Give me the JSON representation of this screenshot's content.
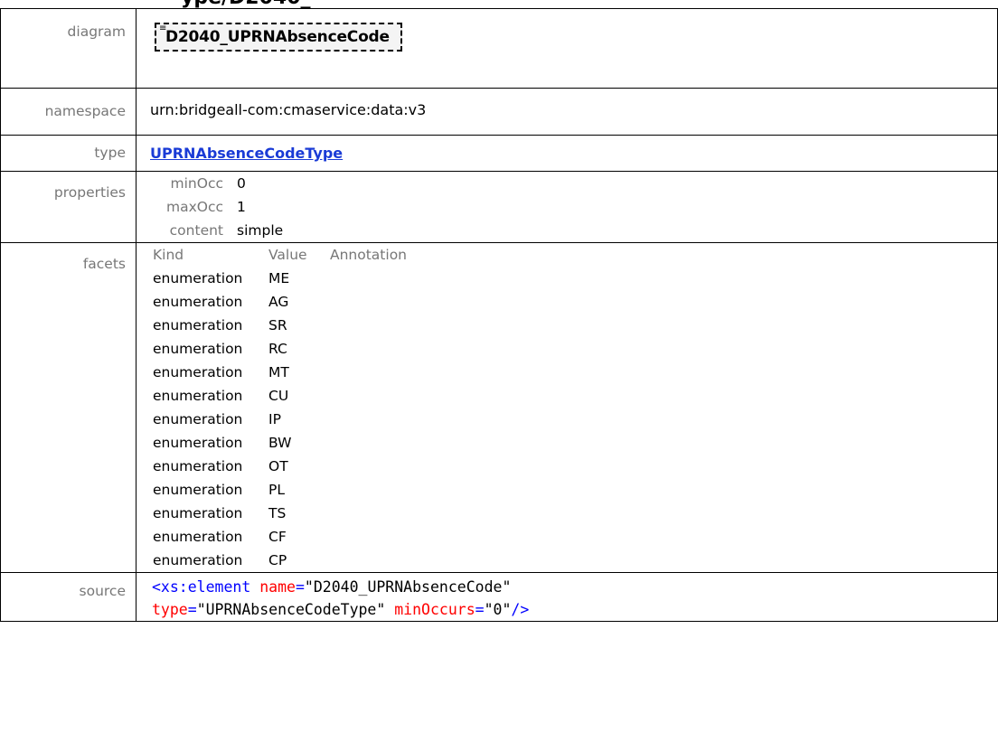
{
  "heading_partial": "ype/D2040_",
  "rows": {
    "diagram": {
      "label": "diagram",
      "element_name": "D2040_UPRNAbsenceCode"
    },
    "namespace": {
      "label": "namespace",
      "value": "urn:bridgeall-com:cmaservice:data:v3"
    },
    "type": {
      "label": "type",
      "value": "UPRNAbsenceCodeType"
    },
    "properties": {
      "label": "properties",
      "items": [
        {
          "key": "minOcc",
          "value": "0"
        },
        {
          "key": "maxOcc",
          "value": "1"
        },
        {
          "key": "content",
          "value": "simple"
        }
      ]
    },
    "facets": {
      "label": "facets",
      "headers": [
        "Kind",
        "Value",
        "Annotation"
      ],
      "items": [
        {
          "kind": "enumeration",
          "value": "ME"
        },
        {
          "kind": "enumeration",
          "value": "AG"
        },
        {
          "kind": "enumeration",
          "value": "SR"
        },
        {
          "kind": "enumeration",
          "value": "RC"
        },
        {
          "kind": "enumeration",
          "value": "MT"
        },
        {
          "kind": "enumeration",
          "value": "CU"
        },
        {
          "kind": "enumeration",
          "value": "IP"
        },
        {
          "kind": "enumeration",
          "value": "BW"
        },
        {
          "kind": "enumeration",
          "value": "OT"
        },
        {
          "kind": "enumeration",
          "value": "PL"
        },
        {
          "kind": "enumeration",
          "value": "TS"
        },
        {
          "kind": "enumeration",
          "value": "CF"
        },
        {
          "kind": "enumeration",
          "value": "CP"
        }
      ]
    },
    "source": {
      "label": "source",
      "tag_open": "<xs:element",
      "attr1_name": "name",
      "attr1_value": "\"D2040_UPRNAbsenceCode\"",
      "attr2_name": "type",
      "attr2_value": "\"UPRNAbsenceCodeType\"",
      "attr3_name": "minOccurs",
      "attr3_value": "\"0\"",
      "tag_close": "/>"
    }
  },
  "colors": {
    "link": "#1a3bd6",
    "label": "#777777",
    "code_tag": "#0000ff",
    "code_attr": "#ff0000"
  }
}
